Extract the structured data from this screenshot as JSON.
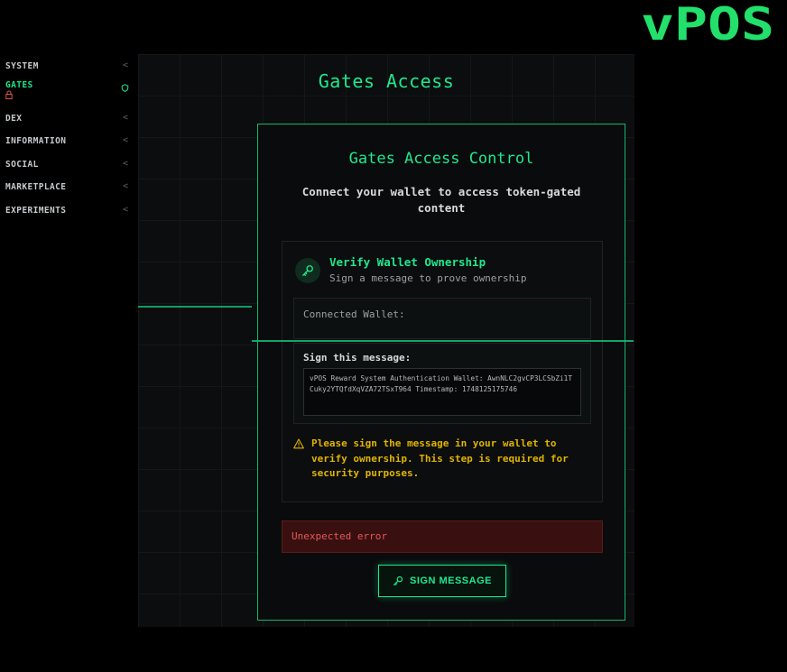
{
  "brand": {
    "logo_text": "vPOS",
    "accent": "#1fe890"
  },
  "sidebar": {
    "items": [
      {
        "label": "SYSTEM",
        "active": false
      },
      {
        "label": "GATES",
        "active": true
      },
      {
        "label": "DEX",
        "active": false
      },
      {
        "label": "INFORMATION",
        "active": false
      },
      {
        "label": "SOCIAL",
        "active": false
      },
      {
        "label": "MARKETPLACE",
        "active": false
      },
      {
        "label": "EXPERIMENTS",
        "active": false
      }
    ],
    "chevron": "<"
  },
  "main": {
    "title": "Gates Access",
    "card": {
      "title": "Gates Access Control",
      "subtitle": "Connect your wallet to access token-gated content",
      "verify": {
        "icon": "key-icon",
        "title": "Verify Wallet Ownership",
        "subtitle": "Sign a message to prove ownership",
        "connected_wallet_label": "Connected Wallet:",
        "sign_label": "Sign this message:",
        "message": "vPOS Reward System Authentication Wallet: AwnNLC2gvCP3LCSbZi1TCuky2YTQfdXqVZA72TSxT964 Timestamp: 1748125175746",
        "warning": "Please sign the message in your wallet to verify ownership. This step is required for security purposes."
      },
      "error": "Unexpected error",
      "sign_button": "SIGN MESSAGE"
    }
  },
  "colors": {
    "accent": "#1fe890",
    "warning": "#e0b400",
    "error": "#e15a5a",
    "lock": "#e0524f"
  }
}
